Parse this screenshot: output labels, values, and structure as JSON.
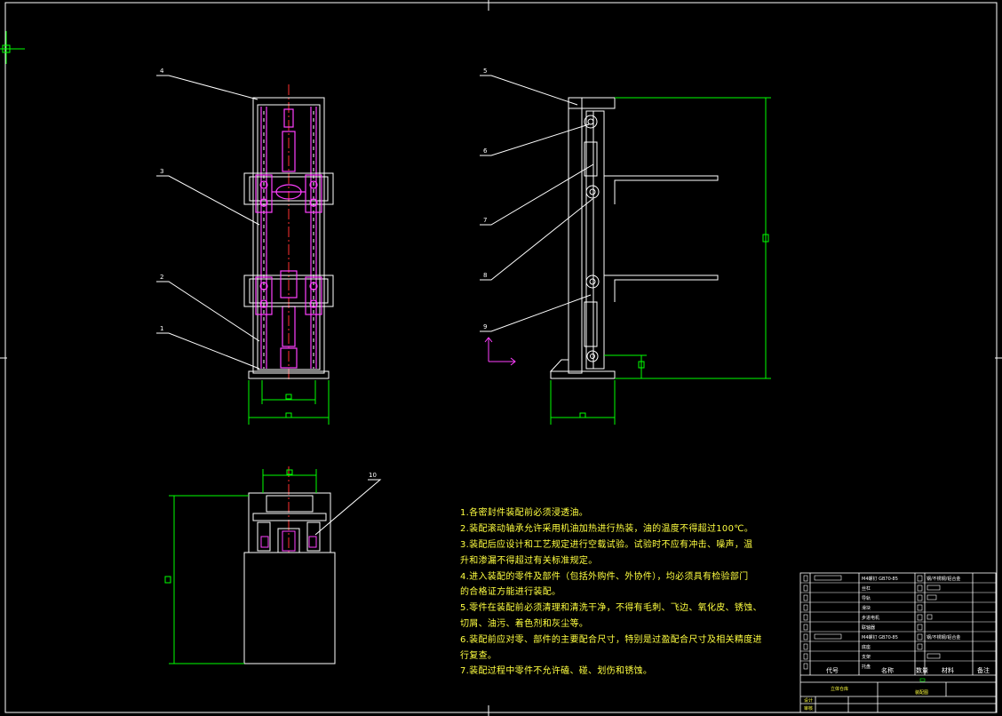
{
  "balloons": {
    "b1": "1",
    "b2": "2",
    "b3": "3",
    "b4": "4",
    "b5": "5",
    "b6": "6",
    "b7": "7",
    "b8": "8",
    "b9": "9",
    "b10": "10"
  },
  "notes": [
    "1.各密封件装配前必须浸透油。",
    "2.装配滚动轴承允许采用机油加热进行热装，油的温度不得超过100℃。",
    "3.装配后应设计和工艺规定进行空载试验。试验时不应有冲击、噪声，温",
    "升和渗漏不得超过有关标准规定。",
    "4.进入装配的零件及部件（包括外购件、外协件），均必须具有检验部门",
    "的合格证方能进行装配。",
    "5.零件在装配前必须清理和清洗干净，不得有毛刺、飞边、氧化皮、锈蚀、",
    "切屑、油污、着色剂和灰尘等。",
    "6.装配前应对零、部件的主要配合尺寸，特别是过盈配合尺寸及相关精度进",
    "行复查。",
    "7.装配过程中零件不允许磕、碰、划伤和锈蚀。"
  ],
  "title_block": {
    "header_code": "代号",
    "header_name": "名称",
    "header_qty": "数量",
    "header_material": "材料",
    "header_remark": "备注",
    "rows": [
      {
        "name": "M4螺钉 GB70-85",
        "material": "钢/不锈钢/铝合金"
      },
      {
        "name": "丝杠",
        "material": ""
      },
      {
        "name": "导轨",
        "material": ""
      },
      {
        "name": "滑块",
        "material": ""
      },
      {
        "name": "步进电机",
        "material": ""
      },
      {
        "name": "联轴器",
        "material": ""
      },
      {
        "name": "底座",
        "material": ""
      },
      {
        "name": "M4螺钉 GB70-85",
        "material": "钢/不锈钢/铝合金"
      },
      {
        "name": "支架",
        "material": ""
      },
      {
        "name": "托盘",
        "material": ""
      }
    ],
    "drawing_name": "立体仓库",
    "designer_label": "设计",
    "checker_label": "审核",
    "company": "装配图"
  },
  "colors": {
    "background": "#000000",
    "line": "#ffffff",
    "part": "#ff3fff",
    "dimension": "#00ff00",
    "center": "#ff3030",
    "text": "#ffff40"
  }
}
